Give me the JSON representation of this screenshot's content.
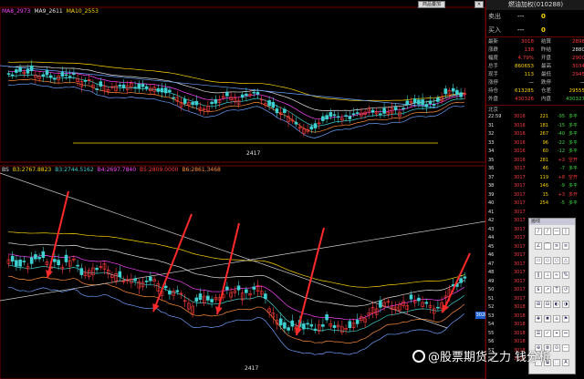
{
  "main_chart": {
    "indicators": [
      {
        "text": "MA8_2973",
        "color": "#ff45ff"
      },
      {
        "text": "MA9_2611",
        "color": "#e6e6e6"
      },
      {
        "text": "MA10_2553",
        "color": "#ffd400"
      }
    ],
    "low_label": "2417"
  },
  "sub_chart": {
    "indicators": [
      {
        "text": "BS",
        "color": "#e6e6e6"
      },
      {
        "text": "B3:2767.8823",
        "color": "#ffd400"
      },
      {
        "text": "B3:2744.5162",
        "color": "#3fd0d0"
      },
      {
        "text": "B4:2697.7840",
        "color": "#ff45ff"
      },
      {
        "text": "B5:2809.0000",
        "color": "#ff3b3b"
      },
      {
        "text": "B6:2861.3468",
        "color": "#ff8c3b"
      }
    ],
    "low_label": "2417",
    "price_tag": "3028"
  },
  "top_buttons": [
    "商品叠加",
    "✕"
  ],
  "panel": {
    "title": "燃油加权(010288)",
    "sell": {
      "label": "卖出",
      "price": "---",
      "vol": "0"
    },
    "buy": {
      "label": "买入",
      "price": "---",
      "vol": "0"
    },
    "quote": [
      {
        "l1": "最新",
        "v1": "3018",
        "c1": "red",
        "l2": "结算",
        "v2": "2898",
        "c2": "red"
      },
      {
        "l1": "涨跌",
        "v1": "138",
        "c1": "red",
        "l2": "昨结",
        "v2": "2880",
        "c2": "wht"
      },
      {
        "l1": "幅度",
        "v1": "4.79%",
        "c1": "red",
        "l2": "开盘",
        "v2": "2900",
        "c2": "red"
      },
      {
        "l1": "总手",
        "v1": "860653",
        "c1": "yel",
        "l2": "最高",
        "v2": "3034",
        "c2": "red"
      },
      {
        "l1": "现手",
        "v1": "113",
        "c1": "yel",
        "l2": "最低",
        "v2": "2945",
        "c2": "red"
      },
      {
        "l1": "涨停",
        "v1": "—",
        "c1": "wht",
        "l2": "跌停",
        "v2": "—",
        "c2": "wht"
      },
      {
        "l1": "持仓",
        "v1": "613285",
        "c1": "yel",
        "l2": "仓差",
        "v2": "29555",
        "c2": "yel"
      },
      {
        "l1": "外盘",
        "v1": "430326",
        "c1": "red",
        "l2": "内盘",
        "v2": "430327",
        "c2": "grn"
      }
    ],
    "tick_header": "北京",
    "ticks": [
      {
        "t": "22:59",
        "p": "3016",
        "v": "221",
        "d": "-95",
        "x": "多平"
      },
      {
        "t": "31",
        "p": "3016",
        "v": "181",
        "d": "-15",
        "x": "多平"
      },
      {
        "t": "32",
        "p": "3016",
        "v": "267",
        "d": "-40",
        "x": "多平"
      },
      {
        "t": "33",
        "p": "3016",
        "v": "96",
        "d": "-22",
        "x": "多平"
      },
      {
        "t": "34",
        "p": "3016",
        "v": "60",
        "d": "-12",
        "x": "多平"
      },
      {
        "t": "35",
        "p": "3016",
        "v": "281",
        "d": "+3",
        "x": "空开"
      },
      {
        "t": "36",
        "p": "3017",
        "v": "46",
        "d": "-7",
        "x": "多平"
      },
      {
        "t": "37",
        "p": "3017",
        "v": "119",
        "d": "+8",
        "x": "空开"
      },
      {
        "t": "38",
        "p": "3017",
        "v": "146",
        "d": "-9",
        "x": "多平"
      },
      {
        "t": "39",
        "p": "3017",
        "v": "15",
        "d": "+3",
        "x": "多开"
      },
      {
        "t": "40",
        "p": "3017",
        "v": "254",
        "d": "-5",
        "x": "多平"
      },
      {
        "t": "41",
        "p": "3017",
        "v": "",
        "d": "",
        "x": ""
      },
      {
        "t": "42",
        "p": "3017",
        "v": "",
        "d": "",
        "x": ""
      },
      {
        "t": "43",
        "p": "3017",
        "v": "",
        "d": "",
        "x": ""
      },
      {
        "t": "44",
        "p": "3017",
        "v": "",
        "d": "",
        "x": ""
      },
      {
        "t": "45",
        "p": "3017",
        "v": "",
        "d": "",
        "x": ""
      },
      {
        "t": "46",
        "p": "3017",
        "v": "",
        "d": "",
        "x": ""
      },
      {
        "t": "47",
        "p": "3017",
        "v": "",
        "d": "",
        "x": ""
      },
      {
        "t": "48",
        "p": "3017",
        "v": "",
        "d": "",
        "x": ""
      },
      {
        "t": "49",
        "p": "3017",
        "v": "",
        "d": "",
        "x": ""
      },
      {
        "t": "50",
        "p": "3017",
        "v": "",
        "d": "",
        "x": ""
      },
      {
        "t": "51",
        "p": "3017",
        "v": "",
        "d": "",
        "x": ""
      },
      {
        "t": "52",
        "p": "3018",
        "v": "",
        "d": "",
        "x": ""
      },
      {
        "t": "53",
        "p": "3018",
        "v": "",
        "d": "",
        "x": ""
      },
      {
        "t": "54",
        "p": "3018",
        "v": "",
        "d": "",
        "x": ""
      },
      {
        "t": "55",
        "p": "3018",
        "v": "",
        "d": "",
        "x": ""
      },
      {
        "t": "56",
        "p": "3018",
        "v": "",
        "d": "",
        "x": ""
      },
      {
        "t": "57",
        "p": "3018",
        "v": "",
        "d": "",
        "x": ""
      },
      {
        "t": "58",
        "p": "3018",
        "v": "",
        "d": "",
        "x": ""
      }
    ]
  },
  "toolbox": {
    "title": "画线",
    "tools": [
      "/",
      "/",
      "—",
      "|",
      "∠",
      "⌒",
      "≡",
      "≡",
      "▭",
      "◇",
      "○",
      "△",
      "‖",
      "⊥",
      "≈",
      "%",
      "$",
      "↗",
      "T",
      "↺",
      "⊞",
      "⊟",
      "◐",
      "◑",
      "✚",
      "✖",
      "⌂",
      "⚑",
      "☰",
      "✓",
      "⌖",
      "⇔",
      "⊕",
      "⊗",
      "⊙",
      "⋯",
      "⋮",
      "⧉",
      "⬚",
      "A"
    ]
  },
  "watermark": "@股票期货之力 钱分析"
}
